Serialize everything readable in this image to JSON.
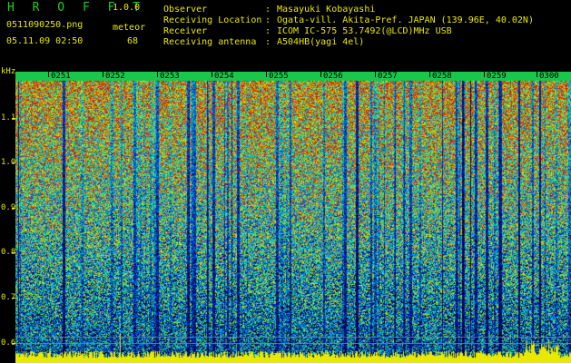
{
  "header": {
    "app_title": "H R O F F T",
    "version": "1.0.0",
    "filename": "0511090250.png",
    "mode_label": "meteor",
    "timestamp": "05.11.09 02:50",
    "count": "68",
    "info": [
      {
        "key": "Observer",
        "value": "Masayuki Kobayashi"
      },
      {
        "key": "Receiving Location",
        "value": "Ogata-vill. Akita-Pref. JAPAN (139.96E, 40.02N)"
      },
      {
        "key": "Receiver",
        "value": "ICOM IC-575 53.7492(@LCD)MHz USB"
      },
      {
        "key": "Receiving antenna",
        "value": "A504HB(yagi 4el)"
      }
    ]
  },
  "spectrogram": {
    "y_unit": "kHz",
    "y_ticks": [
      "1.1",
      "1.0",
      "0.9",
      "0.8",
      "0.7",
      "0.6"
    ],
    "time_ticks": [
      "0251",
      "0252",
      "0253",
      "0254",
      "0255",
      "0256",
      "0257",
      "0258",
      "0259",
      "0300"
    ],
    "colors": {
      "background": "#000000",
      "label": "#e8e800",
      "title": "#19d219"
    }
  }
}
